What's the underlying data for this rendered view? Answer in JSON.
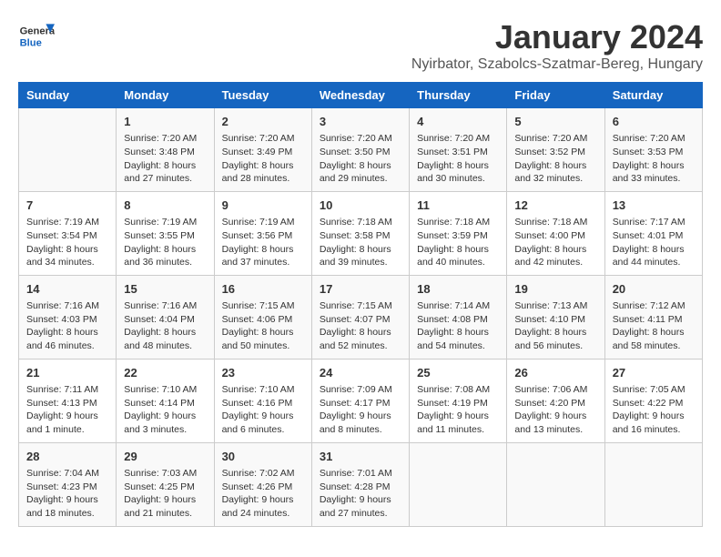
{
  "logo": {
    "line1": "General",
    "line2": "Blue"
  },
  "title": "January 2024",
  "subtitle": "Nyirbator, Szabolcs-Szatmar-Bereg, Hungary",
  "days_of_week": [
    "Sunday",
    "Monday",
    "Tuesday",
    "Wednesday",
    "Thursday",
    "Friday",
    "Saturday"
  ],
  "weeks": [
    [
      {
        "day": "",
        "info": ""
      },
      {
        "day": "1",
        "info": "Sunrise: 7:20 AM\nSunset: 3:48 PM\nDaylight: 8 hours\nand 27 minutes."
      },
      {
        "day": "2",
        "info": "Sunrise: 7:20 AM\nSunset: 3:49 PM\nDaylight: 8 hours\nand 28 minutes."
      },
      {
        "day": "3",
        "info": "Sunrise: 7:20 AM\nSunset: 3:50 PM\nDaylight: 8 hours\nand 29 minutes."
      },
      {
        "day": "4",
        "info": "Sunrise: 7:20 AM\nSunset: 3:51 PM\nDaylight: 8 hours\nand 30 minutes."
      },
      {
        "day": "5",
        "info": "Sunrise: 7:20 AM\nSunset: 3:52 PM\nDaylight: 8 hours\nand 32 minutes."
      },
      {
        "day": "6",
        "info": "Sunrise: 7:20 AM\nSunset: 3:53 PM\nDaylight: 8 hours\nand 33 minutes."
      }
    ],
    [
      {
        "day": "7",
        "info": "Sunrise: 7:19 AM\nSunset: 3:54 PM\nDaylight: 8 hours\nand 34 minutes."
      },
      {
        "day": "8",
        "info": "Sunrise: 7:19 AM\nSunset: 3:55 PM\nDaylight: 8 hours\nand 36 minutes."
      },
      {
        "day": "9",
        "info": "Sunrise: 7:19 AM\nSunset: 3:56 PM\nDaylight: 8 hours\nand 37 minutes."
      },
      {
        "day": "10",
        "info": "Sunrise: 7:18 AM\nSunset: 3:58 PM\nDaylight: 8 hours\nand 39 minutes."
      },
      {
        "day": "11",
        "info": "Sunrise: 7:18 AM\nSunset: 3:59 PM\nDaylight: 8 hours\nand 40 minutes."
      },
      {
        "day": "12",
        "info": "Sunrise: 7:18 AM\nSunset: 4:00 PM\nDaylight: 8 hours\nand 42 minutes."
      },
      {
        "day": "13",
        "info": "Sunrise: 7:17 AM\nSunset: 4:01 PM\nDaylight: 8 hours\nand 44 minutes."
      }
    ],
    [
      {
        "day": "14",
        "info": "Sunrise: 7:16 AM\nSunset: 4:03 PM\nDaylight: 8 hours\nand 46 minutes."
      },
      {
        "day": "15",
        "info": "Sunrise: 7:16 AM\nSunset: 4:04 PM\nDaylight: 8 hours\nand 48 minutes."
      },
      {
        "day": "16",
        "info": "Sunrise: 7:15 AM\nSunset: 4:06 PM\nDaylight: 8 hours\nand 50 minutes."
      },
      {
        "day": "17",
        "info": "Sunrise: 7:15 AM\nSunset: 4:07 PM\nDaylight: 8 hours\nand 52 minutes."
      },
      {
        "day": "18",
        "info": "Sunrise: 7:14 AM\nSunset: 4:08 PM\nDaylight: 8 hours\nand 54 minutes."
      },
      {
        "day": "19",
        "info": "Sunrise: 7:13 AM\nSunset: 4:10 PM\nDaylight: 8 hours\nand 56 minutes."
      },
      {
        "day": "20",
        "info": "Sunrise: 7:12 AM\nSunset: 4:11 PM\nDaylight: 8 hours\nand 58 minutes."
      }
    ],
    [
      {
        "day": "21",
        "info": "Sunrise: 7:11 AM\nSunset: 4:13 PM\nDaylight: 9 hours\nand 1 minute."
      },
      {
        "day": "22",
        "info": "Sunrise: 7:10 AM\nSunset: 4:14 PM\nDaylight: 9 hours\nand 3 minutes."
      },
      {
        "day": "23",
        "info": "Sunrise: 7:10 AM\nSunset: 4:16 PM\nDaylight: 9 hours\nand 6 minutes."
      },
      {
        "day": "24",
        "info": "Sunrise: 7:09 AM\nSunset: 4:17 PM\nDaylight: 9 hours\nand 8 minutes."
      },
      {
        "day": "25",
        "info": "Sunrise: 7:08 AM\nSunset: 4:19 PM\nDaylight: 9 hours\nand 11 minutes."
      },
      {
        "day": "26",
        "info": "Sunrise: 7:06 AM\nSunset: 4:20 PM\nDaylight: 9 hours\nand 13 minutes."
      },
      {
        "day": "27",
        "info": "Sunrise: 7:05 AM\nSunset: 4:22 PM\nDaylight: 9 hours\nand 16 minutes."
      }
    ],
    [
      {
        "day": "28",
        "info": "Sunrise: 7:04 AM\nSunset: 4:23 PM\nDaylight: 9 hours\nand 18 minutes."
      },
      {
        "day": "29",
        "info": "Sunrise: 7:03 AM\nSunset: 4:25 PM\nDaylight: 9 hours\nand 21 minutes."
      },
      {
        "day": "30",
        "info": "Sunrise: 7:02 AM\nSunset: 4:26 PM\nDaylight: 9 hours\nand 24 minutes."
      },
      {
        "day": "31",
        "info": "Sunrise: 7:01 AM\nSunset: 4:28 PM\nDaylight: 9 hours\nand 27 minutes."
      },
      {
        "day": "",
        "info": ""
      },
      {
        "day": "",
        "info": ""
      },
      {
        "day": "",
        "info": ""
      }
    ]
  ]
}
